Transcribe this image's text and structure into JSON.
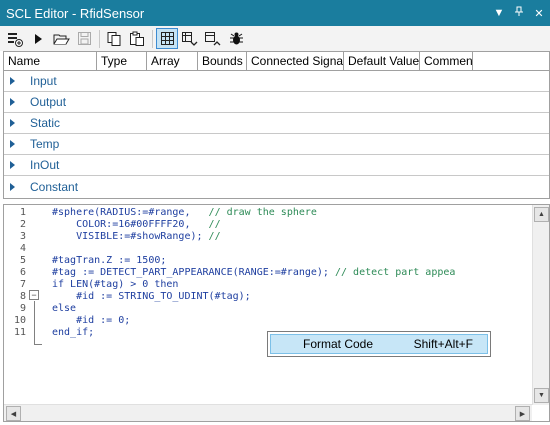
{
  "window": {
    "title": "SCL Editor  - RfidSensor",
    "controls": [
      "▼",
      "▮",
      "✕"
    ]
  },
  "toolbar": {
    "buttons": [
      "add-item-icon",
      "run-icon",
      "open-folder-icon",
      "save-icon",
      "copy-icon",
      "paste-icon",
      "grid-view-icon",
      "expand-down-icon",
      "collapse-up-icon",
      "debug-bug-icon"
    ]
  },
  "table": {
    "columns": [
      "Name",
      "Type",
      "Array",
      "Bounds",
      "Connected Signal",
      "Default Value",
      "Comment"
    ],
    "sections": [
      "Input",
      "Output",
      "Static",
      "Temp",
      "InOut",
      "Constant"
    ]
  },
  "editor": {
    "line_numbers": [
      "1",
      "2",
      "3",
      "4",
      "5",
      "6",
      "7",
      "8",
      "9",
      "10",
      "11"
    ],
    "lines": [
      {
        "indent": "",
        "code": "#sphere(RADIUS:=#range,",
        "comment": "// draw the sphere"
      },
      {
        "indent": "    ",
        "code": "COLOR:=16#00FFFF20,",
        "comment": "//"
      },
      {
        "indent": "    ",
        "code": "VISIBLE:=#showRange);",
        "comment": "//"
      },
      {
        "indent": "",
        "code": "",
        "comment": ""
      },
      {
        "indent": "",
        "code": "#tagTran.Z := 1500;",
        "comment": ""
      },
      {
        "indent": "",
        "code": "#tag := DETECT_PART_APPEARANCE(RANGE:=#range);",
        "comment": "// detect part appea"
      },
      {
        "indent": "",
        "code": "if LEN(#tag) > 0 then",
        "comment": ""
      },
      {
        "indent": "    ",
        "code": "#id := STRING_TO_UDINT(#tag);",
        "comment": ""
      },
      {
        "indent": "",
        "code": "else",
        "comment": ""
      },
      {
        "indent": "    ",
        "code": "#id := 0;",
        "comment": ""
      },
      {
        "indent": "",
        "code": "end_if;",
        "comment": ""
      }
    ]
  },
  "context_menu": {
    "item_label": "Format Code",
    "shortcut": "Shift+Alt+F"
  },
  "colors": {
    "titlebar": "#1a7d9e",
    "keyword": "#1f3fa0",
    "comment": "#2e8b57",
    "menu_highlight": "#c7e6f7"
  }
}
